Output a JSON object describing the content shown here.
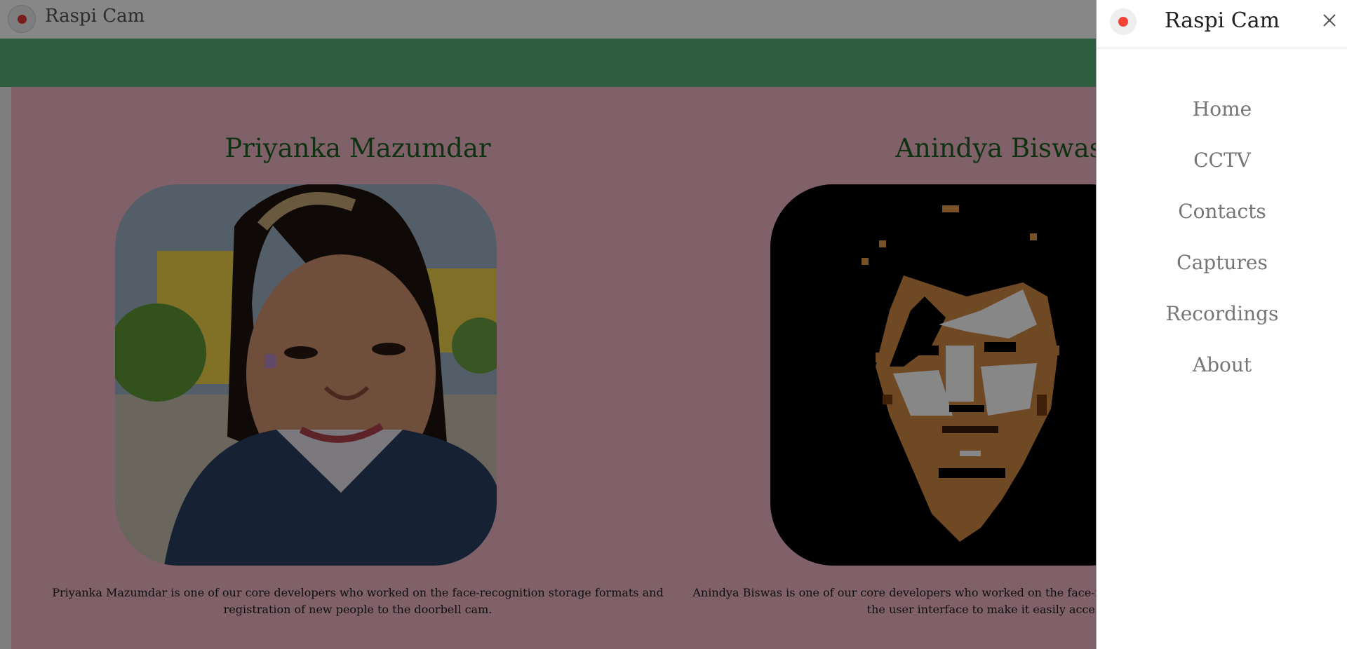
{
  "app": {
    "title": "Raspi Cam",
    "accent_color": "#58b07a",
    "record_dot_color": "#e53935"
  },
  "team": [
    {
      "name": "Priyanka Mazumdar",
      "photo": "portrait photo",
      "bio": "Priyanka Mazumdar is one of our core developers who worked on the face-recognition storage formats and registration of new people to the doorbell cam."
    },
    {
      "name": "Anindya Biswas",
      "photo": "pixel-art portrait",
      "bio": "Anindya Biswas is one of our core developers who worked on the face-recognition system for use as well as the user interface to make it easily accessible."
    }
  ],
  "drawer": {
    "title": "Raspi Cam",
    "close_icon": "close-icon",
    "items": [
      "Home",
      "CCTV",
      "Contacts",
      "Captures",
      "Recordings",
      "About"
    ]
  }
}
